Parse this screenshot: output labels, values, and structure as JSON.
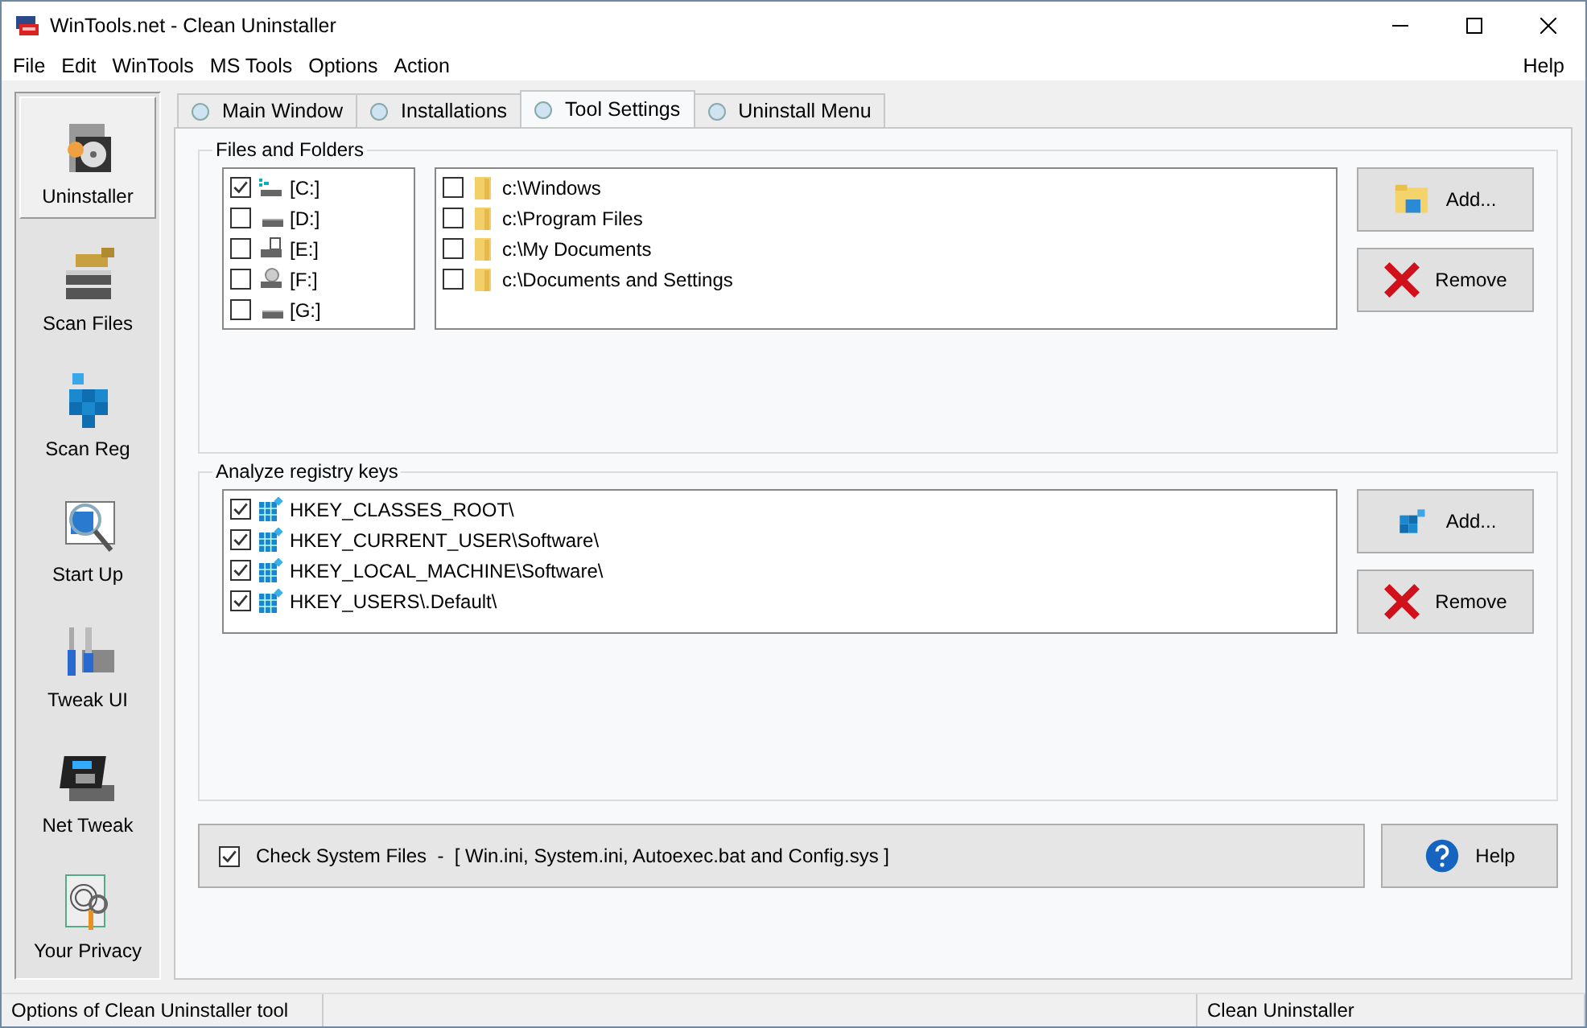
{
  "window": {
    "title": "WinTools.net - Clean Uninstaller"
  },
  "menu": [
    "File",
    "Edit",
    "WinTools",
    "MS Tools",
    "Options",
    "Action"
  ],
  "menu_right": "Help",
  "sidebar": {
    "items": [
      {
        "label": "Uninstaller",
        "kind": "uninstaller",
        "selected": true
      },
      {
        "label": "Scan Files",
        "kind": "files",
        "selected": false
      },
      {
        "label": "Scan Reg",
        "kind": "reg",
        "selected": false
      },
      {
        "label": "Start Up",
        "kind": "startup",
        "selected": false
      },
      {
        "label": "Tweak UI",
        "kind": "tweak",
        "selected": false
      },
      {
        "label": "Net Tweak",
        "kind": "net",
        "selected": false
      },
      {
        "label": "Your Privacy",
        "kind": "privacy",
        "selected": false
      }
    ]
  },
  "tabs": [
    {
      "label": "Main Window",
      "selected": false
    },
    {
      "label": "Installations",
      "selected": false
    },
    {
      "label": "Tool Settings",
      "selected": true
    },
    {
      "label": "Uninstall Menu",
      "selected": false
    }
  ],
  "files_and_folders": {
    "title": "Files and Folders",
    "drives": [
      {
        "label": "[C:]",
        "kind": "system",
        "checked": true
      },
      {
        "label": "[D:]",
        "kind": "disk",
        "checked": false
      },
      {
        "label": "[E:]",
        "kind": "floppy",
        "checked": false
      },
      {
        "label": "[F:]",
        "kind": "cd",
        "checked": false
      },
      {
        "label": "[G:]",
        "kind": "disk",
        "checked": false
      }
    ],
    "folders": [
      {
        "label": "c:\\Windows",
        "checked": false
      },
      {
        "label": "c:\\Program Files",
        "checked": false
      },
      {
        "label": "c:\\My Documents",
        "checked": false
      },
      {
        "label": "c:\\Documents and Settings",
        "checked": false
      }
    ],
    "buttons": [
      {
        "label": "Add...",
        "kind": "folder"
      },
      {
        "label": "Remove",
        "kind": "remove"
      }
    ]
  },
  "registry": {
    "title": "Analyze registry keys",
    "keys": [
      {
        "label": "HKEY_CLASSES_ROOT\\",
        "checked": true
      },
      {
        "label": "HKEY_CURRENT_USER\\Software\\",
        "checked": true
      },
      {
        "label": "HKEY_LOCAL_MACHINE\\Software\\",
        "checked": true
      },
      {
        "label": "HKEY_USERS\\.Default\\",
        "checked": true
      }
    ],
    "buttons": [
      {
        "label": "Add...",
        "kind": "reg"
      },
      {
        "label": "Remove",
        "kind": "remove"
      }
    ]
  },
  "check_system_files": {
    "label": "Check System Files  -  [ Win.ini, System.ini, Autoexec.bat and Config.sys ]",
    "checked": true
  },
  "help_button": "Help",
  "status_bar": [
    "Options of Clean Uninstaller tool",
    "Clean Uninstaller"
  ]
}
